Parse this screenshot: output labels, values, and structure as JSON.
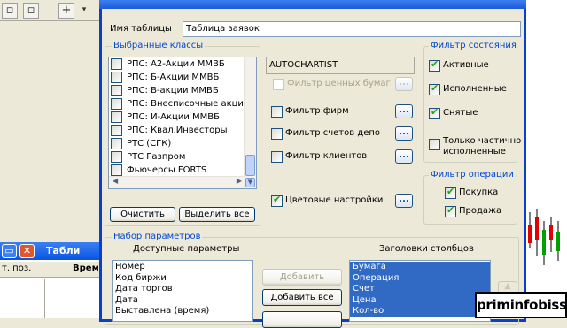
{
  "dialog": {
    "table_name_label": "Имя таблицы",
    "table_name_value": "Таблица заявок",
    "classes_group": "Выбранные классы",
    "classes": [
      {
        "label": "РПС: А2-Акции ММВБ",
        "checked": false
      },
      {
        "label": "РПС: Б-Акции ММВБ",
        "checked": false
      },
      {
        "label": "РПС: В-акции ММВБ",
        "checked": false
      },
      {
        "label": "РПС: Внесписочные акции I",
        "checked": false
      },
      {
        "label": "РПС: И-Акции ММВБ",
        "checked": false
      },
      {
        "label": "РПС: Квал.Инвесторы",
        "checked": false
      },
      {
        "label": "РТС (СГК)",
        "checked": false
      },
      {
        "label": "РТС Газпром",
        "checked": false
      },
      {
        "label": "Фьючерсы FORTS",
        "checked": false
      }
    ],
    "clear_btn": "Очистить",
    "select_all_btn": "Выделить все",
    "autochartist": "AUTOCHARTIST",
    "securities_filter": "Фильтр ценных бумаг",
    "dots": "...",
    "firm_filter": "Фильтр фирм",
    "depo_filter": "Фильтр счетов депо",
    "client_filter": "Фильтр клиентов",
    "color_settings": "Цветовые настройки",
    "state_group": "Фильтр состояния",
    "state": [
      {
        "label": "Активные",
        "checked": true
      },
      {
        "label": "Исполненные",
        "checked": true
      },
      {
        "label": "Снятые",
        "checked": true
      }
    ],
    "partial_1": "Только частично",
    "partial_2": "исполненные",
    "op_group": "Фильтр операции",
    "ops": [
      {
        "label": "Покупка",
        "checked": true
      },
      {
        "label": "Продажа",
        "checked": true
      }
    ],
    "params_group": "Набор параметров",
    "available_params": "Доступные параметры",
    "column_headers": "Заголовки столбцов",
    "available_list": [
      "Номер",
      "Код биржи",
      "Дата торгов",
      "Дата",
      "Выставлена (время)"
    ],
    "add_btn": "Добавить",
    "add_all_btn": "Добавить все",
    "columns_list": [
      "Бумага",
      "Операция",
      "Счет",
      "Цена",
      "Кол-во"
    ]
  },
  "background": {
    "window_title": "Табли",
    "col1": "т. поз.",
    "col2": "Врем"
  },
  "logo": "priminfobiss"
}
